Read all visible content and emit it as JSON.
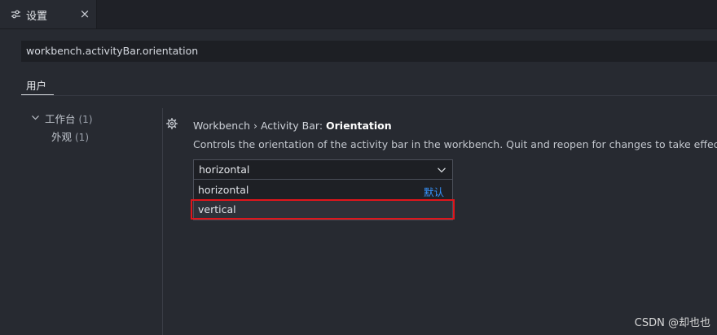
{
  "tab": {
    "icon": "settings-sliders-icon",
    "label": "设置",
    "close": "×"
  },
  "search": {
    "value": "workbench.activityBar.orientation"
  },
  "scope": {
    "user_tab": "用户"
  },
  "toc": {
    "items": [
      {
        "label": "工作台",
        "count": "(1)",
        "expanded": true
      },
      {
        "label": "外观",
        "count": "(1)"
      }
    ]
  },
  "setting": {
    "gear_icon": "gear-icon",
    "title_prefix": "Workbench › Activity Bar: ",
    "title_strong": "Orientation",
    "description": "Controls the orientation of the activity bar in the workbench. Quit and reopen for changes to take effect.",
    "current_value": "horizontal",
    "options": [
      {
        "label": "horizontal",
        "badge": "默认"
      },
      {
        "label": "vertical",
        "badge": ""
      }
    ]
  },
  "watermark": "CSDN @却也也",
  "colors": {
    "highlight": "#e0151b",
    "link": "#3794ff"
  }
}
